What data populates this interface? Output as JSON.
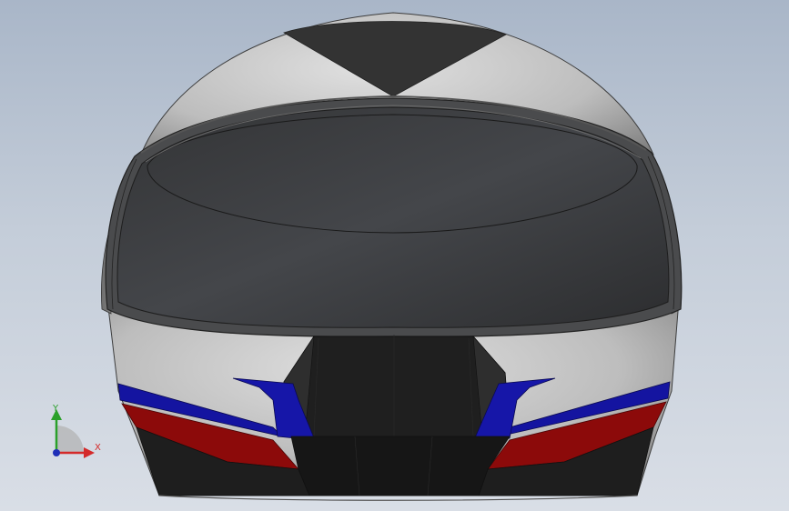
{
  "viewport": {
    "background_top": "#a9b6c8",
    "background_bottom": "#d9dee6"
  },
  "model": {
    "shell_light": "#c9c9c9",
    "shell_dark": "#2f2f2f",
    "visor": "#3a3b3c",
    "accent_blue": "#1414a0",
    "accent_red": "#8c0a0a"
  },
  "triad": {
    "y_label": "Y",
    "x_label": "X",
    "y_color": "#2aa02a",
    "x_color": "#d42a2a",
    "z_color": "#1f2fb8",
    "icons": {
      "y": "y-axis-arrow",
      "x": "x-axis-arrow",
      "z": "z-axis-point"
    }
  }
}
